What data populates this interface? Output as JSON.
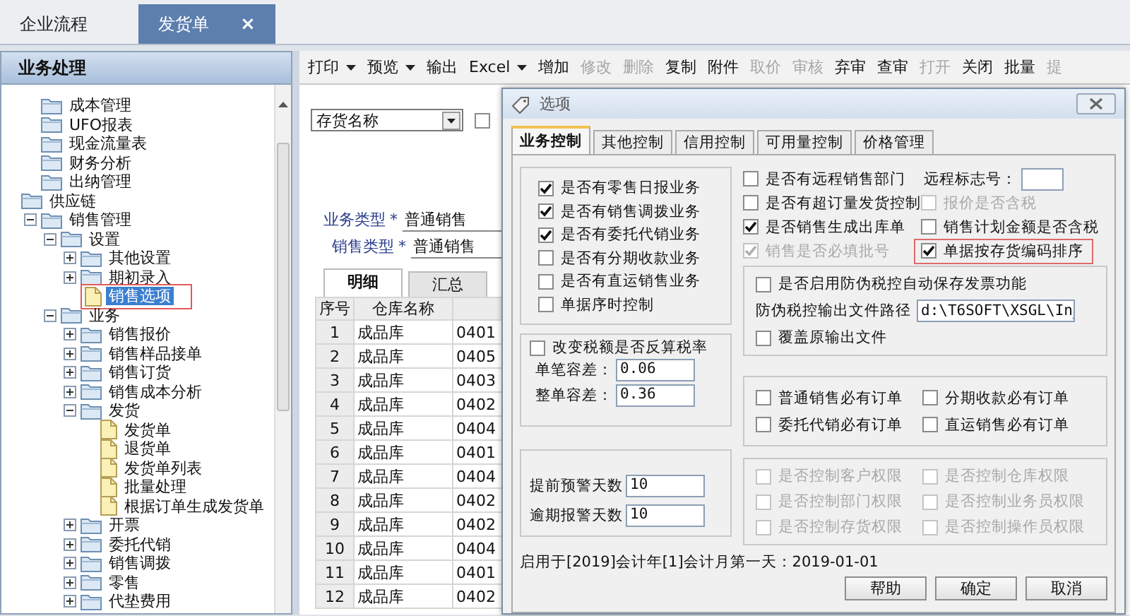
{
  "top_tabs": [
    {
      "label": "企业流程",
      "selected": false
    },
    {
      "label": "发货单",
      "selected": true,
      "close": "×"
    }
  ],
  "sidebar": {
    "title": "业务处理",
    "tree": {
      "continued_items": [
        {
          "label": "成本管理",
          "kind": "folder",
          "selected": false
        },
        {
          "label": "UFO报表",
          "kind": "folder",
          "selected": false
        },
        {
          "label": "现金流量表",
          "kind": "folder",
          "selected": false
        },
        {
          "label": "财务分析",
          "kind": "folder",
          "selected": false
        },
        {
          "label": "出纳管理",
          "kind": "folder",
          "selected": false
        }
      ],
      "items": [
        {
          "label": "供应链",
          "kind": "folder",
          "selected": false,
          "children": [
            {
              "label": "销售管理",
              "kind": "folder",
              "expanded": true,
              "selected": false,
              "children": [
                {
                  "label": "设置",
                  "kind": "folder",
                  "expanded": true,
                  "selected": false,
                  "children": [
                    {
                      "label": "其他设置",
                      "kind": "folder",
                      "expanded": false,
                      "selected": false
                    },
                    {
                      "label": "期初录入",
                      "kind": "folder",
                      "expanded": false,
                      "selected": false
                    },
                    {
                      "label": "销售选项",
                      "kind": "document",
                      "selected": true,
                      "highlighted": true
                    }
                  ]
                },
                {
                  "label": "业务",
                  "kind": "folder",
                  "expanded": true,
                  "selected": false,
                  "children": [
                    {
                      "label": "销售报价",
                      "kind": "folder",
                      "expanded": false,
                      "selected": false
                    },
                    {
                      "label": "销售样品接单",
                      "kind": "folder",
                      "expanded": false,
                      "selected": false
                    },
                    {
                      "label": "销售订货",
                      "kind": "folder",
                      "expanded": false,
                      "selected": false
                    },
                    {
                      "label": "销售成本分析",
                      "kind": "folder",
                      "expanded": false,
                      "selected": false
                    },
                    {
                      "label": "发货",
                      "kind": "folder",
                      "expanded": true,
                      "selected": false,
                      "children": [
                        {
                          "label": "发货单",
                          "kind": "document",
                          "selected": false
                        },
                        {
                          "label": "退货单",
                          "kind": "document",
                          "selected": false
                        },
                        {
                          "label": "发货单列表",
                          "kind": "document",
                          "selected": false
                        },
                        {
                          "label": "批量处理",
                          "kind": "document",
                          "selected": false
                        },
                        {
                          "label": "根据订单生成发货单",
                          "kind": "document",
                          "selected": false
                        }
                      ]
                    },
                    {
                      "label": "开票",
                      "kind": "folder",
                      "expanded": false,
                      "selected": false
                    },
                    {
                      "label": "委托代销",
                      "kind": "folder",
                      "expanded": false,
                      "selected": false
                    },
                    {
                      "label": "销售调拨",
                      "kind": "folder",
                      "expanded": false,
                      "selected": false
                    },
                    {
                      "label": "零售",
                      "kind": "folder",
                      "expanded": false,
                      "selected": false
                    },
                    {
                      "label": "代垫费用",
                      "kind": "folder",
                      "expanded": false,
                      "selected": false
                    }
                  ]
                }
              ]
            }
          ]
        }
      ]
    }
  },
  "toolbar": [
    {
      "label": "打印",
      "dropdown": true,
      "disabled": false
    },
    {
      "label": "预览",
      "dropdown": true,
      "disabled": false
    },
    {
      "label": "输出",
      "dropdown": false,
      "disabled": false
    },
    {
      "label": "Excel",
      "dropdown": true,
      "disabled": false
    },
    {
      "label": "增加",
      "dropdown": false,
      "disabled": false
    },
    {
      "label": "修改",
      "dropdown": false,
      "disabled": true
    },
    {
      "label": "删除",
      "dropdown": false,
      "disabled": true
    },
    {
      "label": "复制",
      "dropdown": false,
      "disabled": false
    },
    {
      "label": "附件",
      "dropdown": false,
      "disabled": false
    },
    {
      "label": "取价",
      "dropdown": false,
      "disabled": true
    },
    {
      "label": "审核",
      "dropdown": false,
      "disabled": true
    },
    {
      "label": "弃审",
      "dropdown": false,
      "disabled": false
    },
    {
      "label": "查审",
      "dropdown": false,
      "disabled": false
    },
    {
      "label": "打开",
      "dropdown": false,
      "disabled": true
    },
    {
      "label": "关闭",
      "dropdown": false,
      "disabled": false
    },
    {
      "label": "批量",
      "dropdown": false,
      "disabled": false
    },
    {
      "label": "提",
      "dropdown": false,
      "disabled": true
    }
  ],
  "main": {
    "filter": {
      "value": "存货名称"
    },
    "filter_checkbox": {
      "checked": false
    },
    "fields": [
      {
        "label": "业务类型",
        "required_mark": "*",
        "value": "普通销售"
      },
      {
        "label": "销售类型",
        "required_mark": "*",
        "value": "普通销售"
      }
    ],
    "detail_tabs": [
      {
        "label": "明细",
        "selected": true
      },
      {
        "label": "汇总",
        "selected": false
      }
    ],
    "table": {
      "columns": [
        "序号",
        "仓库名称"
      ],
      "rows": [
        [
          "1",
          "成品库",
          "0401"
        ],
        [
          "2",
          "成品库",
          "0405"
        ],
        [
          "3",
          "成品库",
          "0403"
        ],
        [
          "4",
          "成品库",
          "0402"
        ],
        [
          "5",
          "成品库",
          "0404"
        ],
        [
          "6",
          "成品库",
          "0401"
        ],
        [
          "7",
          "成品库",
          "0404"
        ],
        [
          "8",
          "成品库",
          "0402"
        ],
        [
          "9",
          "成品库",
          "0402"
        ],
        [
          "10",
          "成品库",
          "0404"
        ],
        [
          "11",
          "成品库",
          "0401"
        ],
        [
          "12",
          "成品库",
          "0402"
        ]
      ]
    }
  },
  "dialog": {
    "title": "选项",
    "tabs": [
      {
        "label": "业务控制",
        "selected": true
      },
      {
        "label": "其他控制",
        "selected": false
      },
      {
        "label": "信用控制",
        "selected": false
      },
      {
        "label": "可用量控制",
        "selected": false
      },
      {
        "label": "价格管理",
        "selected": false
      }
    ],
    "business_options": [
      {
        "label": "是否有零售日报业务",
        "checked": true,
        "disabled": false
      },
      {
        "label": "是否有销售调拨业务",
        "checked": true,
        "disabled": false
      },
      {
        "label": "是否有委托代销业务",
        "checked": true,
        "disabled": false
      },
      {
        "label": "是否有分期收款业务",
        "checked": false,
        "disabled": false
      },
      {
        "label": "是否有直运销售业务",
        "checked": false,
        "disabled": false
      },
      {
        "label": "单据序时控制",
        "checked": false,
        "disabled": false
      }
    ],
    "right_rows": [
      [
        {
          "kind": "checkbox",
          "label": "是否有远程销售部门",
          "checked": false,
          "disabled": false
        },
        {
          "kind": "text_input",
          "label": "远程标志号："
        }
      ],
      [
        {
          "kind": "checkbox",
          "label": "是否有超订量发货控制",
          "checked": false,
          "disabled": false
        },
        {
          "kind": "checkbox",
          "label": "报价是否含税",
          "checked": false,
          "disabled": true
        }
      ],
      [
        {
          "kind": "checkbox",
          "label": "是否销售生成出库单",
          "checked": true,
          "disabled": false
        },
        {
          "kind": "checkbox",
          "label": "销售计划金额是否含税",
          "checked": false,
          "disabled": false
        }
      ],
      [
        {
          "kind": "checkbox",
          "label": "销售是否必填批号",
          "checked": true,
          "disabled": true
        },
        {
          "kind": "checkbox",
          "label": "单据按存货编码排序",
          "checked": true,
          "disabled": false,
          "highlighted": true
        }
      ]
    ],
    "tax_control": {
      "auto_save": {
        "label": "是否启用防伪税控自动保存发票功能",
        "checked": false,
        "disabled": false
      },
      "path_label": "防伪税控输出文件路径",
      "path_value": "d:\\T6SOFT\\XSGL\\In",
      "overwrite": {
        "label": "覆盖原输出文件",
        "checked": false,
        "disabled": false
      }
    },
    "tolerance": {
      "recalc": {
        "label": "改变税额是否反算税率",
        "checked": false,
        "disabled": false
      },
      "fields": [
        {
          "label": "单笔容差：",
          "value": "0.06"
        },
        {
          "label": "整单容差：",
          "value": "0.36"
        }
      ]
    },
    "order_options": [
      {
        "label": "普通销售必有订单",
        "checked": false,
        "disabled": false
      },
      {
        "label": "分期收款必有订单",
        "checked": false,
        "disabled": false
      },
      {
        "label": "委托代销必有订单",
        "checked": false,
        "disabled": false
      },
      {
        "label": "直运销售必有订单",
        "checked": false,
        "disabled": false
      }
    ],
    "warning_fields": [
      {
        "label": "提前预警天数",
        "value": "10"
      },
      {
        "label": "逾期报警天数",
        "value": "10"
      }
    ],
    "permission_options": [
      {
        "label": "是否控制客户权限",
        "checked": false,
        "disabled": true
      },
      {
        "label": "是否控制仓库权限",
        "checked": false,
        "disabled": true
      },
      {
        "label": "是否控制部门权限",
        "checked": false,
        "disabled": true
      },
      {
        "label": "是否控制业务员权限",
        "checked": false,
        "disabled": true
      },
      {
        "label": "是否控制存货权限",
        "checked": false,
        "disabled": true
      },
      {
        "label": "是否控制操作员权限",
        "checked": false,
        "disabled": true
      }
    ],
    "footer": "启用于[2019]会计年[1]会计月第一天：2019-01-01",
    "buttons": [
      "帮助",
      "确定",
      "取消"
    ]
  }
}
